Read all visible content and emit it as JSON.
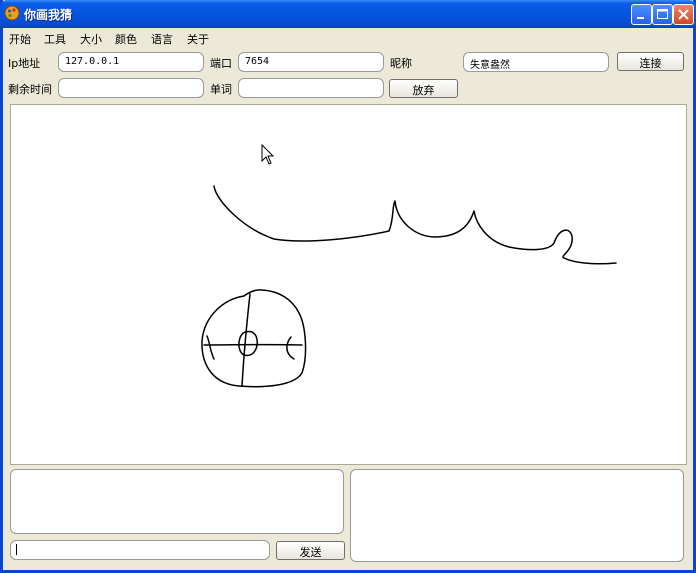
{
  "window": {
    "title": "你画我猜"
  },
  "menu": [
    "开始",
    "工具",
    "大小",
    "颜色",
    "语言",
    "关于"
  ],
  "connection": {
    "ip_label": "Ip地址",
    "ip_value": "127.0.0.1",
    "port_label": "端口",
    "port_value": "7654",
    "nickname_label": "昵称",
    "nickname_value": "失意盎然",
    "connect_button": "连接"
  },
  "game": {
    "time_label": "剩余时间",
    "time_value": "",
    "word_label": "单词",
    "word_value": "",
    "giveup_button": "放弃"
  },
  "chat": {
    "input_value": "",
    "send_button": "发送"
  },
  "colors": {
    "title_bar": "#0a5de8",
    "window_bg": "#ece9d8",
    "stroke": "#000000"
  },
  "icons": [
    "app-icon",
    "minimize-icon",
    "maximize-icon",
    "close-icon",
    "mouse-cursor-icon"
  ]
}
